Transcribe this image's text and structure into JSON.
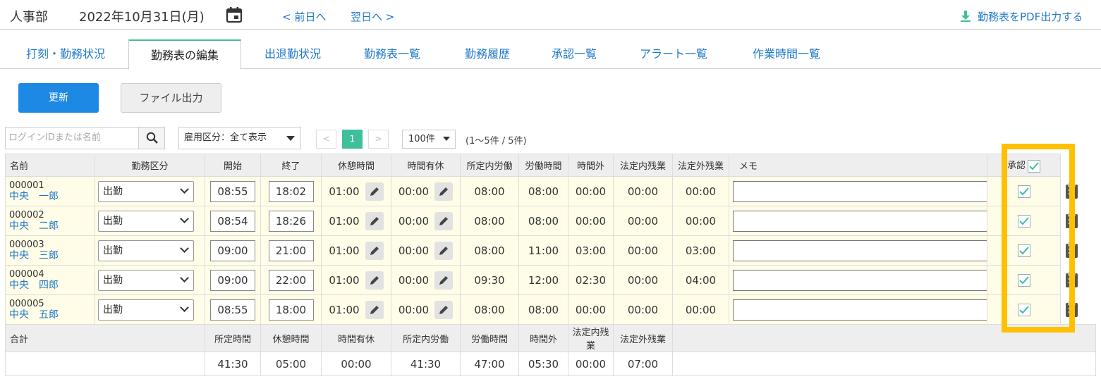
{
  "header": {
    "department": "人事部",
    "date": "2022年10月31日(月)",
    "prev_day": "< 前日へ",
    "next_day": "翌日へ >",
    "pdf_export": "勤務表をPDF出力する"
  },
  "tabs": [
    {
      "label": "打刻・勤務状況",
      "active": false
    },
    {
      "label": "勤務表の編集",
      "active": true
    },
    {
      "label": "出退勤状況",
      "active": false
    },
    {
      "label": "勤務表一覧",
      "active": false
    },
    {
      "label": "勤務履歴",
      "active": false
    },
    {
      "label": "承認一覧",
      "active": false
    },
    {
      "label": "アラート一覧",
      "active": false
    },
    {
      "label": "作業時間一覧",
      "active": false
    }
  ],
  "actions": {
    "update": "更新",
    "file_export": "ファイル出力"
  },
  "filters": {
    "search_placeholder": "ログインIDまたは名前",
    "employment_type": "雇用区分：全て表示",
    "page_prev": "<",
    "page_current": "1",
    "page_next": ">",
    "per_page": "100件",
    "range": "(1〜5件 / 5件)"
  },
  "table": {
    "headers": {
      "name": "名前",
      "work_type": "勤務区分",
      "start": "開始",
      "end": "終了",
      "break": "休憩時間",
      "hourly_leave": "時間有休",
      "scheduled_work": "所定内労働",
      "work_hours": "労働時間",
      "overtime": "時間外",
      "legal_in_ot": "法定内残業",
      "legal_out_ot": "法定外残業",
      "memo": "メモ",
      "approve": "承認"
    },
    "rows": [
      {
        "id": "000001",
        "name": "中央　一郎",
        "work_type": "出勤",
        "start": "08:55",
        "end": "18:02",
        "break": "01:00",
        "hourly_leave": "00:00",
        "scheduled_work": "08:00",
        "work_hours": "08:00",
        "overtime": "00:00",
        "legal_in_ot": "00:00",
        "legal_out_ot": "00:00",
        "memo": "",
        "approved": true
      },
      {
        "id": "000002",
        "name": "中央　二郎",
        "work_type": "出勤",
        "start": "08:54",
        "end": "18:26",
        "break": "01:00",
        "hourly_leave": "00:00",
        "scheduled_work": "08:00",
        "work_hours": "08:00",
        "overtime": "00:00",
        "legal_in_ot": "00:00",
        "legal_out_ot": "00:00",
        "memo": "",
        "approved": true
      },
      {
        "id": "000003",
        "name": "中央　三郎",
        "work_type": "出勤",
        "start": "09:00",
        "end": "21:00",
        "break": "01:00",
        "hourly_leave": "00:00",
        "scheduled_work": "08:00",
        "work_hours": "11:00",
        "overtime": "03:00",
        "legal_in_ot": "00:00",
        "legal_out_ot": "03:00",
        "memo": "",
        "approved": true
      },
      {
        "id": "000004",
        "name": "中央　四郎",
        "work_type": "出勤",
        "start": "09:00",
        "end": "22:00",
        "break": "01:00",
        "hourly_leave": "00:00",
        "scheduled_work": "09:30",
        "work_hours": "12:00",
        "overtime": "02:30",
        "legal_in_ot": "00:00",
        "legal_out_ot": "04:00",
        "memo": "",
        "approved": true
      },
      {
        "id": "000005",
        "name": "中央　五郎",
        "work_type": "出勤",
        "start": "08:55",
        "end": "18:00",
        "break": "01:00",
        "hourly_leave": "00:00",
        "scheduled_work": "08:00",
        "work_hours": "08:00",
        "overtime": "00:00",
        "legal_in_ot": "00:00",
        "legal_out_ot": "00:00",
        "memo": "",
        "approved": true
      }
    ],
    "summary": {
      "label": "合計",
      "headers": {
        "scheduled": "所定時間",
        "break": "休憩時間",
        "hourly_leave": "時間有休",
        "scheduled_work": "所定内労働",
        "work_hours": "労働時間",
        "overtime": "時間外",
        "legal_in_ot": "法定内残業",
        "legal_out_ot": "法定外残業"
      },
      "values": {
        "scheduled": "41:30",
        "break": "05:00",
        "hourly_leave": "00:00",
        "scheduled_work": "41:30",
        "work_hours": "47:00",
        "overtime": "05:30",
        "legal_in_ot": "00:00",
        "legal_out_ot": "07:00"
      }
    }
  },
  "colors": {
    "accent_blue": "#1e88e5",
    "link_blue": "#1f78c9",
    "active_tab_green": "#3fbf9a",
    "row_yellow": "#fffde7",
    "highlight_orange": "#ffc000"
  }
}
